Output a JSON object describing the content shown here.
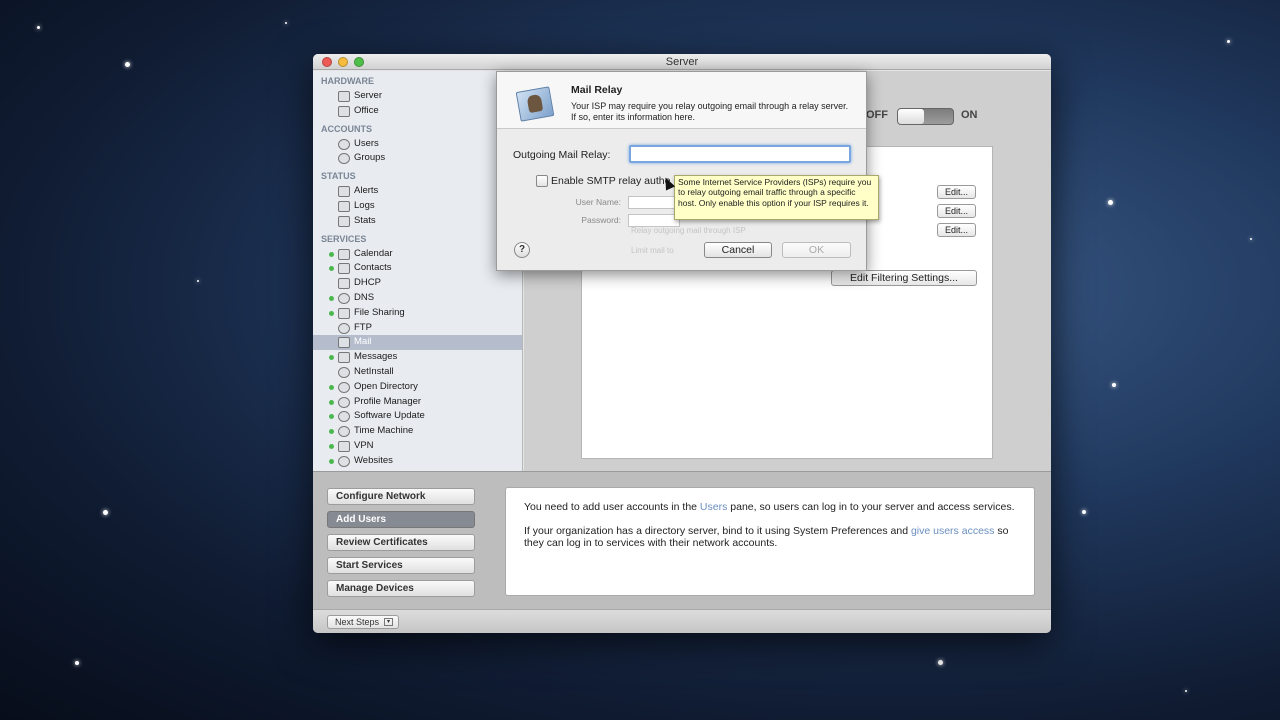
{
  "window": {
    "title": "Server"
  },
  "sidebar": {
    "sections": [
      {
        "header": "HARDWARE",
        "items": [
          {
            "label": "Server",
            "icon": "server-icon",
            "status": ""
          },
          {
            "label": "Office",
            "icon": "office-icon",
            "status": ""
          }
        ]
      },
      {
        "header": "ACCOUNTS",
        "items": [
          {
            "label": "Users",
            "icon": "user-icon",
            "status": ""
          },
          {
            "label": "Groups",
            "icon": "groups-icon",
            "status": ""
          }
        ]
      },
      {
        "header": "STATUS",
        "items": [
          {
            "label": "Alerts",
            "icon": "alerts-icon",
            "status": ""
          },
          {
            "label": "Logs",
            "icon": "logs-icon",
            "status": ""
          },
          {
            "label": "Stats",
            "icon": "stats-icon",
            "status": ""
          }
        ]
      },
      {
        "header": "SERVICES",
        "items": [
          {
            "label": "Calendar",
            "icon": "calendar-icon",
            "status": "on"
          },
          {
            "label": "Contacts",
            "icon": "contacts-icon",
            "status": "on"
          },
          {
            "label": "DHCP",
            "icon": "dhcp-icon",
            "status": ""
          },
          {
            "label": "DNS",
            "icon": "dns-icon",
            "status": "on"
          },
          {
            "label": "File Sharing",
            "icon": "file-sharing-icon",
            "status": "on"
          },
          {
            "label": "FTP",
            "icon": "ftp-icon",
            "status": ""
          },
          {
            "label": "Mail",
            "icon": "mail-icon",
            "status": "",
            "selected": true
          },
          {
            "label": "Messages",
            "icon": "messages-icon",
            "status": "on"
          },
          {
            "label": "NetInstall",
            "icon": "netinstall-icon",
            "status": ""
          },
          {
            "label": "Open Directory",
            "icon": "open-directory-icon",
            "status": "on"
          },
          {
            "label": "Profile Manager",
            "icon": "profile-manager-icon",
            "status": "on"
          },
          {
            "label": "Software Update",
            "icon": "software-update-icon",
            "status": "on"
          },
          {
            "label": "Time Machine",
            "icon": "time-machine-icon",
            "status": "on"
          },
          {
            "label": "VPN",
            "icon": "vpn-icon",
            "status": "on"
          },
          {
            "label": "Websites",
            "icon": "websites-icon",
            "status": "on"
          }
        ]
      }
    ]
  },
  "mail_pane": {
    "off_label": "OFF",
    "on_label": "ON",
    "edit_label": "Edit...",
    "filter_button": "Edit Filtering Settings..."
  },
  "sheet": {
    "title": "Mail Relay",
    "description": "Your ISP may require you relay outgoing email through a relay server.  If so, enter its information here.",
    "relay_label": "Outgoing Mail Relay:",
    "relay_value": "",
    "smtp_label": "Enable SMTP relay authe",
    "username_label": "User Name:",
    "password_label": "Password:",
    "ghost_1": "Relay outgoing mail through ISP",
    "ghost_2": "Limit mail to",
    "help_label": "?",
    "cancel_label": "Cancel",
    "ok_label": "OK"
  },
  "tooltip": {
    "text": "Some Internet Service Providers (ISPs) require you to relay outgoing email traffic through a specific host.  Only enable this option if your ISP requires it."
  },
  "next_steps": {
    "buttons": [
      "Configure Network",
      "Add Users",
      "Review Certificates",
      "Start Services",
      "Manage Devices"
    ],
    "active": "Add Users",
    "info_1_before": "You need to add user accounts in the ",
    "info_1_link": "Users",
    "info_1_after": " pane, so users can log in to your server and access services.",
    "info_2_before": "If your organization has a directory server, bind to it using System Preferences and ",
    "info_2_link": "give users access",
    "info_2_after": " so they can log in to services with their network accounts.",
    "footer_button": "Next Steps"
  },
  "colors": {
    "status_on": "#4bb84e",
    "link": "#6a8fbf",
    "tooltip_bg": "#ffffc7"
  }
}
